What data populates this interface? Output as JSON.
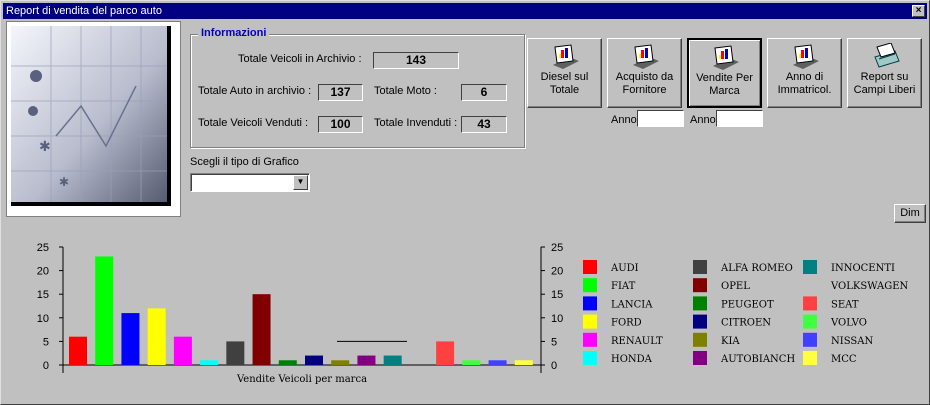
{
  "window": {
    "title": "Report di vendita del parco auto",
    "close_label": "×"
  },
  "info": {
    "title": "Informazioni",
    "totale_veicoli_label": "Totale Veicoli in Archivio :",
    "totale_veicoli_value": "143",
    "totale_auto_label": "Totale Auto in archivio  :",
    "totale_auto_value": "137",
    "totale_moto_label": "Totale Moto :",
    "totale_moto_value": "6",
    "venduti_label": "Totale Veicoli Venduti :",
    "venduti_value": "100",
    "invenduti_label": "Totale Invenduti :",
    "invenduti_value": "43"
  },
  "toolbar": {
    "buttons": [
      {
        "line1": "Diesel sul",
        "line2": "Totale",
        "icon": "report-icon"
      },
      {
        "line1": "Acquisto da",
        "line2": "Fornitore",
        "icon": "report-icon"
      },
      {
        "line1": "Vendite Per",
        "line2": "Marca",
        "icon": "report-icon"
      },
      {
        "line1": "Anno di",
        "line2": "Immatricol.",
        "icon": "report-icon"
      },
      {
        "line1": "Report su",
        "line2": "Campi Liberi",
        "icon": "printer-icon"
      }
    ],
    "anno_label": "Anno",
    "anno_value_1": "",
    "anno_value_2": ""
  },
  "combo": {
    "label": "Scegli il tipo di Grafico",
    "value": ""
  },
  "dim_button": "Dim",
  "colors": {
    "titlebar": "#000080",
    "info_title": "#0000c0",
    "face": "#c0c0c0"
  },
  "chart_data": {
    "type": "bar",
    "xlabel": "Vendite Veicoli per marca",
    "ylim": [
      0,
      25
    ],
    "yticks": [
      0,
      5,
      10,
      15,
      20,
      25
    ],
    "ytick_labels": [
      "0",
      "5",
      "10",
      "15",
      "20",
      "25"
    ],
    "series": [
      {
        "name": "AUDI",
        "value": 6,
        "color": "#ff0000"
      },
      {
        "name": "FIAT",
        "value": 23,
        "color": "#00ff00"
      },
      {
        "name": "LANCIA",
        "value": 11,
        "color": "#0000ff"
      },
      {
        "name": "FORD",
        "value": 12,
        "color": "#ffff00"
      },
      {
        "name": "RENAULT",
        "value": 6,
        "color": "#ff00ff"
      },
      {
        "name": "HONDA",
        "value": 1,
        "color": "#00ffff"
      },
      {
        "name": "ALFA ROMEO",
        "value": 5,
        "color": "#404040"
      },
      {
        "name": "OPEL",
        "value": 15,
        "color": "#800000"
      },
      {
        "name": "PEUGEOT",
        "value": 1,
        "color": "#008000"
      },
      {
        "name": "CITROEN",
        "value": 2,
        "color": "#000080"
      },
      {
        "name": "KIA",
        "value": 1,
        "color": "#808000"
      },
      {
        "name": "AUTOBIANCH",
        "value": 2,
        "color": "#800080"
      },
      {
        "name": "INNOCENTI",
        "value": 2,
        "color": "#008080"
      },
      {
        "name": "VOLKSWAGEN",
        "value": 0,
        "color": "#c0c0c0"
      },
      {
        "name": "SEAT",
        "value": 5,
        "color": "#ff4040"
      },
      {
        "name": "VOLVO",
        "value": 1,
        "color": "#40ff40"
      },
      {
        "name": "NISSAN",
        "value": 1,
        "color": "#4040ff"
      },
      {
        "name": "MCC",
        "value": 1,
        "color": "#ffff40"
      }
    ]
  }
}
